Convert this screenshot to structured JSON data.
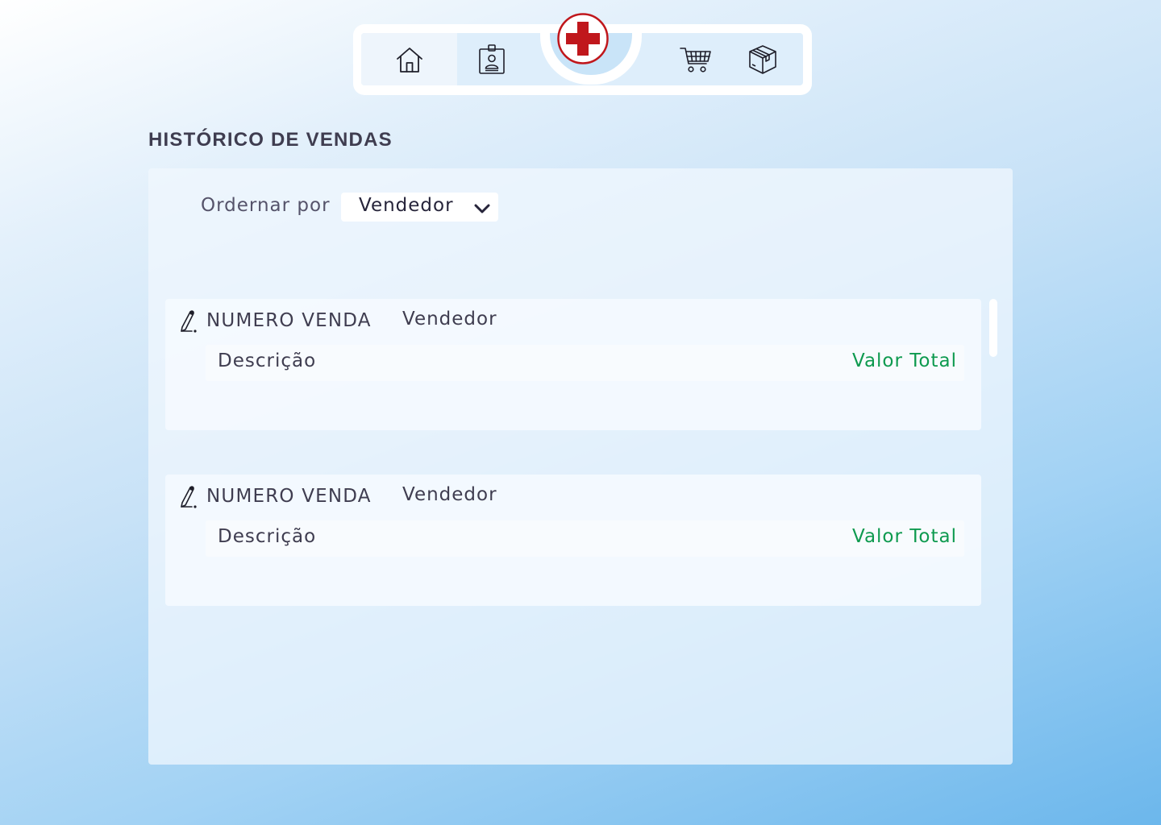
{
  "nav": {
    "items": [
      {
        "id": "home",
        "icon": "home-icon",
        "active": true
      },
      {
        "id": "employees",
        "icon": "id-badge-icon",
        "active": false
      },
      {
        "id": "cart",
        "icon": "shopping-cart-icon",
        "active": false
      },
      {
        "id": "products",
        "icon": "package-box-icon",
        "active": false
      }
    ],
    "logo_icon": "medical-cross-icon",
    "logo_color": "#c0171c"
  },
  "page": {
    "title": "HISTÓRICO DE VENDAS"
  },
  "sort": {
    "label": "Ordernar por",
    "selected": "Vendedor"
  },
  "sales": [
    {
      "number": "NUMERO VENDA",
      "seller": "Vendedor",
      "description": "Descrição",
      "total": "Valor Total"
    },
    {
      "number": "NUMERO VENDA",
      "seller": "Vendedor",
      "description": "Descrição",
      "total": "Valor Total"
    }
  ],
  "colors": {
    "accent_green": "#0e9a4f",
    "text_dark": "#3f3d50"
  }
}
